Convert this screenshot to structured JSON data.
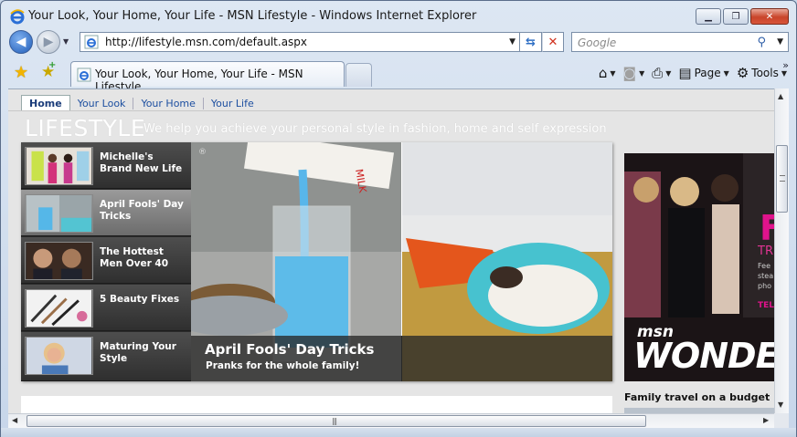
{
  "window": {
    "title": "Your Look, Your Home, Your Life - MSN Lifestyle - Windows Internet Explorer",
    "minimize_glyph": "▁",
    "maximize_glyph": "❐",
    "close_glyph": "✕"
  },
  "navigation": {
    "back_glyph": "◀",
    "forward_glyph": "▶",
    "dropdown_glyph": "▼",
    "address": "http://lifestyle.msn.com/default.aspx",
    "refresh_glyph": "⇆",
    "stop_glyph": "✕",
    "search_placeholder": "Google",
    "search_glyph": "⚲"
  },
  "tabs": {
    "active_label": "Your Look, Your Home, Your Life - MSN Lifestyle",
    "more_glyph": "»"
  },
  "command_bar": {
    "home_glyph": "⌂",
    "feeds_glyph": "◙",
    "print_glyph": "⎙",
    "page_label": "Page",
    "tools_label": "Tools",
    "tools_glyph": "⚙"
  },
  "site": {
    "nav": [
      "Home",
      "Your Look",
      "Your Home",
      "Your Life"
    ],
    "brand": "LIFESTYLE",
    "tagline": "We help you achieve your personal style in fashion, home and self expression"
  },
  "feature": {
    "items": [
      {
        "label": "Michelle's Brand New Life",
        "thumb": "two-women-thumbnail",
        "selected": false
      },
      {
        "label": "April Fools' Day Tricks",
        "thumb": "blue-milk-thumbnail",
        "selected": true
      },
      {
        "label": "The Hottest Men Over 40",
        "thumb": "men-portraits-thumbnail",
        "selected": false
      },
      {
        "label": "5 Beauty Fixes",
        "thumb": "makeup-brushes-thumbnail",
        "selected": false
      },
      {
        "label": "Maturing Your Style",
        "thumb": "smiling-woman-thumbnail",
        "selected": false
      }
    ],
    "hero_title": "April Fools' Day Tricks",
    "hero_subtitle": "Pranks for the whole family!",
    "copyright_mark": "®"
  },
  "advert": {
    "msn": "msn",
    "wonder": "WONDER",
    "letter": "F",
    "small": "TR",
    "tiny": "Fee stea pho",
    "tel": "TEL"
  },
  "sidebar": {
    "heading": "Family travel on a budget"
  },
  "scrollbars": {
    "up_glyph": "▲",
    "down_glyph": "▼",
    "left_glyph": "◀",
    "right_glyph": "▶",
    "grip_glyph": "|||"
  },
  "colors": {
    "ie_blue": "#1f5cb8",
    "brand_white": "#ffffff",
    "ad_pink": "#e0138c"
  }
}
